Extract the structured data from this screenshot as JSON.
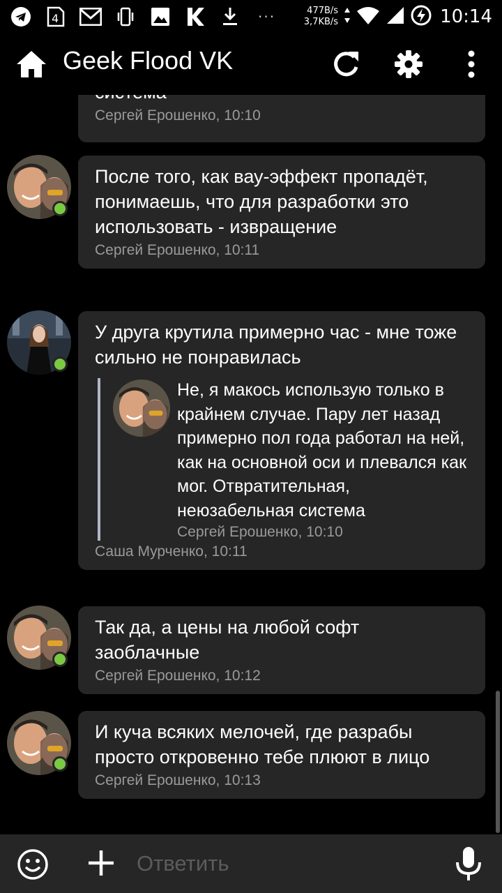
{
  "status_bar": {
    "net_speed_down": "477B/s",
    "net_speed_up": "3,7KB/s",
    "time": "10:14",
    "dots": "···",
    "icons": [
      "telegram-icon",
      "sim-4-icon",
      "gmail-icon",
      "vibrate-icon",
      "image-icon",
      "kinopoisk-icon",
      "download-icon",
      "wifi-icon",
      "signal-icon",
      "battery-charging-icon"
    ]
  },
  "app_bar": {
    "title": "Geek Flood VK",
    "icons": [
      "home-icon",
      "refresh-icon",
      "gear-icon",
      "more-vert-icon"
    ]
  },
  "messages": [
    {
      "text": "система",
      "meta": "Сергей Ерошенко, 10:10"
    },
    {
      "text": "После того, как вау-эффект пропадёт, понимаешь, что для разработки это использовать - извращение",
      "meta": "Сергей Ерошенко, 10:11"
    },
    {
      "text": "У друга крутила примерно час - мне тоже сильно не понравилась",
      "quote": {
        "text": "Не, я макось использую только в крайнем случае. Пару лет назад примерно пол года работал на ней, как на основной оси и плевался как мог. Отвратительная, неюзабельная система",
        "meta": "Сергей Ерошенко, 10:10"
      },
      "meta": "Саша Мурченко, 10:11"
    },
    {
      "text": "Так да, а цены на любой софт заоблачные",
      "meta": "Сергей Ерошенко, 10:12"
    },
    {
      "text": "И куча всяких мелочей, где разрабы просто откровенно тебе плюют в лицо",
      "meta": "Сергей Ерошенко, 10:13"
    }
  ],
  "input_bar": {
    "placeholder": "Ответить",
    "icons": [
      "emoji-icon",
      "add-icon",
      "mic-icon"
    ]
  },
  "colors": {
    "background": "#000000",
    "bubble": "#262626",
    "meta_text": "#9a9a9a",
    "online": "#7ac943",
    "quote_bar": "#b0b8c6"
  }
}
